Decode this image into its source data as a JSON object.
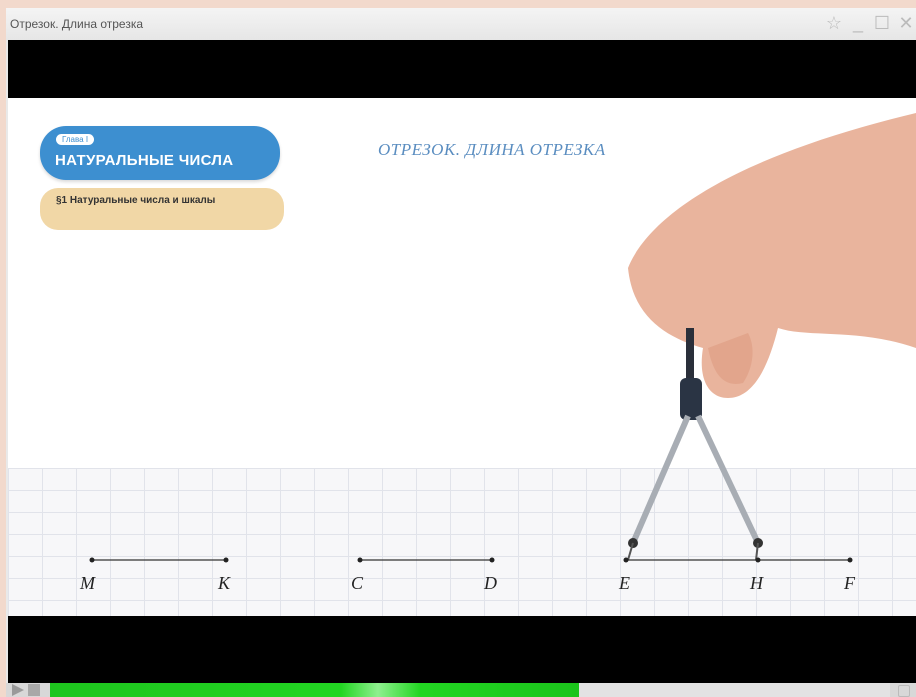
{
  "window": {
    "title": "Отрезок. Длина отрезка"
  },
  "lesson": {
    "chapter_label": "Глава I",
    "chapter_title": "НАТУРАЛЬНЫЕ ЧИСЛА",
    "section": "§1 Натуральные числа и шкалы",
    "title": "ОТРЕЗОК. ДЛИНА ОТРЕЗКА"
  },
  "points": {
    "M": "M",
    "K": "K",
    "C": "C",
    "D": "D",
    "E": "E",
    "H": "H",
    "F": "F"
  },
  "player": {
    "progress": 0.63
  },
  "colors": {
    "chapter_badge": "#3d8fd0",
    "section_badge": "#f1d7a6",
    "title_text": "#5a8dc0",
    "progress_fill": "#22d622"
  },
  "icons": [
    "play-icon",
    "stop-icon",
    "star-icon",
    "minimize-icon",
    "maximize-icon",
    "close-icon",
    "volume-icon"
  ]
}
